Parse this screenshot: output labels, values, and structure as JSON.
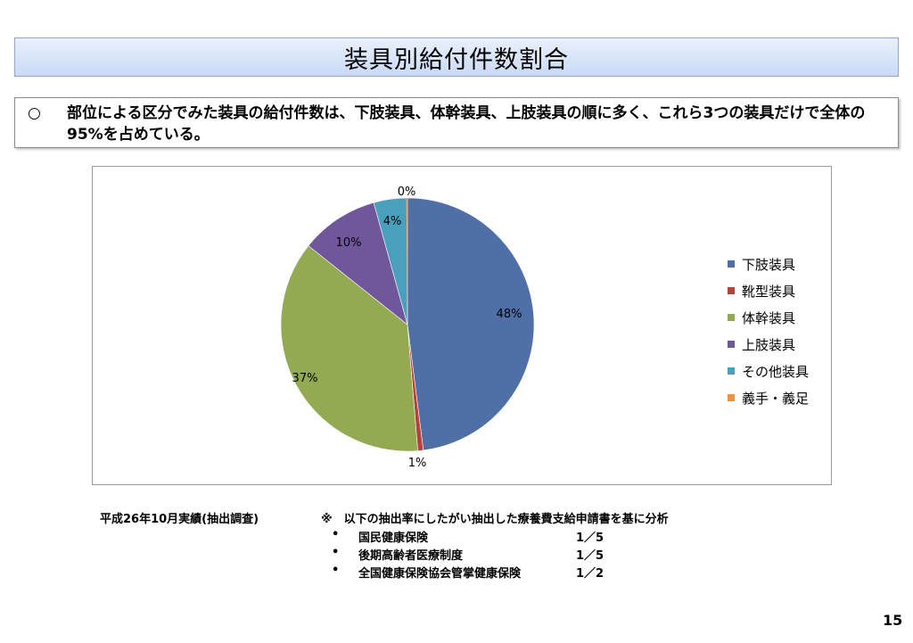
{
  "page": {
    "title": "装具別給付件数割合",
    "summary_mark": "○",
    "summary_text": "部位による区分でみた装具の給付件数は、下肢装具、体幹装具、上肢装具の順に多く、これら3つの装具だけで全体の95%を占めている。",
    "page_number": "15"
  },
  "footnotes": {
    "period": "平成26年10月実績(抽出調査)",
    "note": "※　以下の抽出率にしたがい抽出した療養費支給申請書を基に分析",
    "items": [
      {
        "bullet": "•",
        "name": "国民健康保険",
        "ratio": "1／5"
      },
      {
        "bullet": "•",
        "name": "後期高齢者医療制度",
        "ratio": "1／5"
      },
      {
        "bullet": "•",
        "name": "全国健康保険協会管掌健康保険",
        "ratio": "1／2"
      }
    ]
  },
  "chart_data": {
    "type": "pie",
    "title": "",
    "legend_position": "right",
    "slices": [
      {
        "name": "下肢装具",
        "value": 48,
        "label": "48%",
        "color": "#4f6fa6"
      },
      {
        "name": "靴型装具",
        "value": 0.7,
        "label": "1%",
        "color": "#b8413c"
      },
      {
        "name": "体幹装具",
        "value": 37,
        "label": "37%",
        "color": "#94aa52"
      },
      {
        "name": "上肢装具",
        "value": 10,
        "label": "10%",
        "color": "#70569a"
      },
      {
        "name": "その他装具",
        "value": 4.2,
        "label": "4%",
        "color": "#4a9fbd"
      },
      {
        "name": "義手・義足",
        "value": 0.1,
        "label": "0%",
        "color": "#f0913c"
      }
    ]
  }
}
